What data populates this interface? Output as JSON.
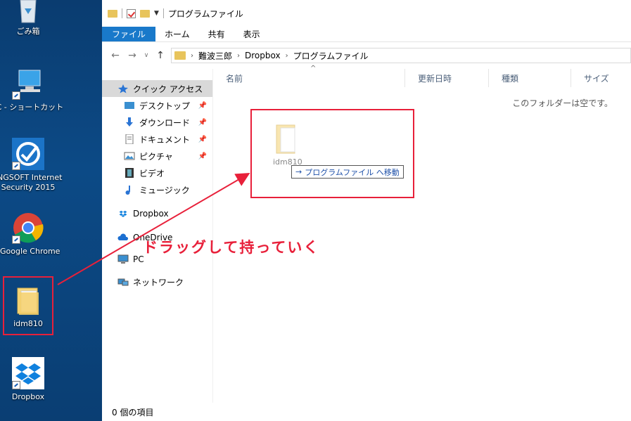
{
  "desktop": {
    "icons": [
      {
        "label": "ごみ箱"
      },
      {
        "label": "PC - ショートカット"
      },
      {
        "label_line1": "NGSOFT Internet",
        "label_line2": "Security 2015"
      },
      {
        "label": "Google Chrome"
      },
      {
        "label": "idm810"
      },
      {
        "label": "Dropbox"
      }
    ]
  },
  "window": {
    "title": "プログラムファイル",
    "ribbon_tabs": [
      "ファイル",
      "ホーム",
      "共有",
      "表示"
    ],
    "breadcrumb": [
      "難波三郎",
      "Dropbox",
      "プログラムファイル"
    ]
  },
  "nav": {
    "quick_access": "クイック アクセス",
    "pinned": [
      "デスクトップ",
      "ダウンロード",
      "ドキュメント",
      "ピクチャ"
    ],
    "others": [
      "ビデオ",
      "ミュージック"
    ],
    "dropbox": "Dropbox",
    "onedrive": "OneDrive",
    "pc": "PC",
    "network": "ネットワーク"
  },
  "columns": [
    "名前",
    "更新日時",
    "種類",
    "サイズ"
  ],
  "empty_message": "このフォルダーは空です。",
  "status": "0 個の項目",
  "drag": {
    "item_name": "idm810",
    "tooltip_arrow": "→",
    "tooltip": "プログラムファイル へ移動"
  },
  "annotation": "ドラッグして持っていく",
  "colors": {
    "annotation_red": "#e8203a",
    "ribbon_blue": "#1979ca",
    "folder": "#e8c45c"
  }
}
